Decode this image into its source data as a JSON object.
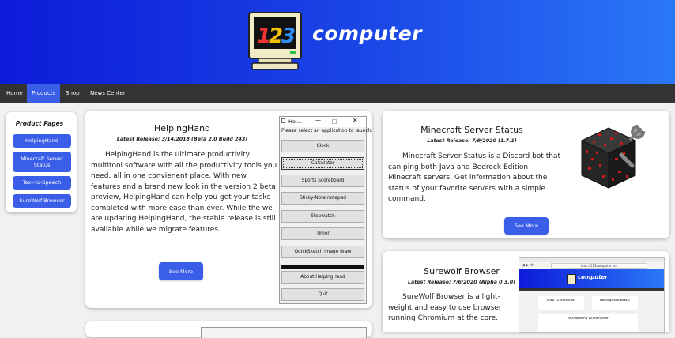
{
  "header": {
    "logo_number": "123",
    "logo_word": "computer"
  },
  "nav": {
    "items": [
      {
        "label": "Home",
        "active": false
      },
      {
        "label": "Products",
        "active": true
      },
      {
        "label": "Shop",
        "active": false
      },
      {
        "label": "News Center",
        "active": false
      }
    ]
  },
  "sidebar": {
    "title": "Product Pages",
    "items": [
      "HelpingHand",
      "Minecraft Server Status",
      "Text-to-Speech",
      "SureWolf Browser"
    ]
  },
  "helpinghand": {
    "title": "HelpingHand",
    "release": "Latest Release: 3/14/2018 (Beta 2.0 Build 243)",
    "description": "HelpingHand is the ultimate productivity multitool software with all the productivity tools you need, all in one convienent place. With new features and a brand new look in the version 2 beta preview, HelpingHand can help you get your tasks completed with more ease than ever. While the we are updating HelpingHand, the stable release is still available while we migrate features.",
    "button": "See More",
    "window": {
      "title": "Hel...",
      "prompt": "Please select an application to launch:",
      "buttons": [
        "Clock",
        "Calculator",
        "Sports Scoreboard",
        "Sticky-Note notepad",
        "Stopwatch",
        "Timer",
        "QuickSketch image draw",
        "About HelpingHand",
        "Quit"
      ]
    }
  },
  "minecraft": {
    "title": "Minecraft Server Status",
    "release": "Latest Release: 7/9/2020 (1.7.1)",
    "description": "Minecraft Server Status is a Discord bot that can ping both Java and Bedrock Edition Minecraft servers. Get information about the status of your favorite servers with a simple command.",
    "button": "See More"
  },
  "surewolf": {
    "title": "Surewolf Browser",
    "release": "Latest Release: 7/6/2020 (Alpha 0.3.0)",
    "description": "SureWolf Browser is a light-weight and easy to use browser running Chromium at the core.",
    "screenshot": {
      "url": "http://123computer.net",
      "logo_word": "computer",
      "tile1_title": "Shop 123computer",
      "tile2_title": "HelpingHand Beta 2",
      "tile3_title": "Re-imagining 123computer"
    }
  }
}
